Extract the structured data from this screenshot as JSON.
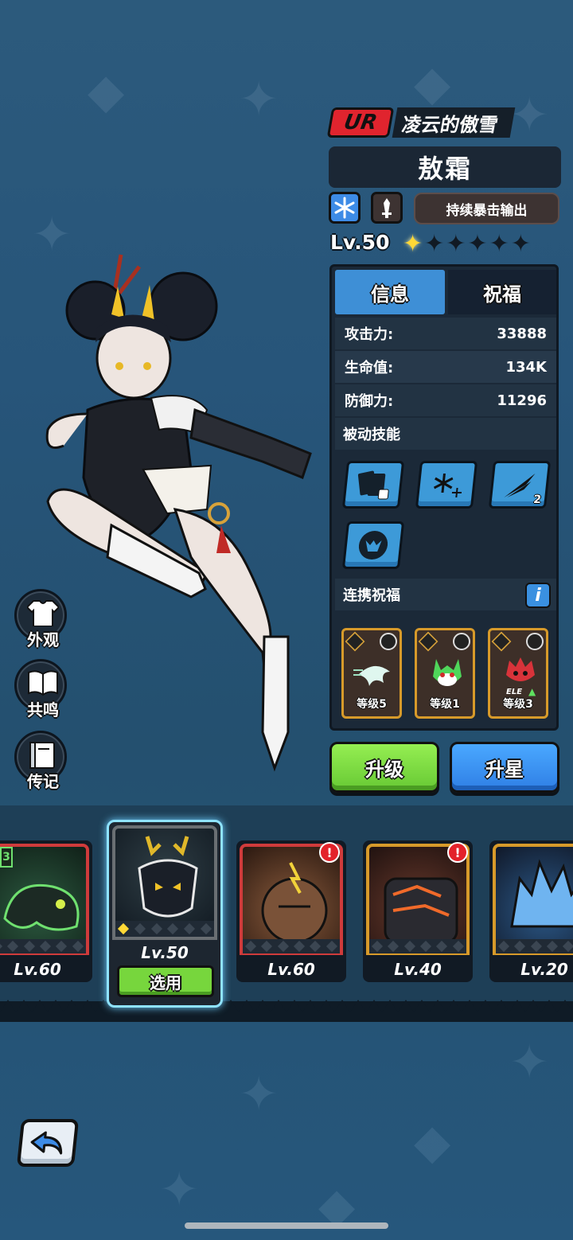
{
  "hero": {
    "rarity": "UR",
    "title": "凌云的傲雪",
    "name": "敖霜",
    "element_icon": "snowflake-icon",
    "type_icon": "sword-icon",
    "trait": "持续暴击输出",
    "level": "Lv.50",
    "stars_total": 6,
    "stars_filled": 1
  },
  "tabs": {
    "info": "信息",
    "blessing": "祝福"
  },
  "stats": [
    {
      "label": "攻击力:",
      "value": "33888"
    },
    {
      "label": "生命值:",
      "value": "134K"
    },
    {
      "label": "防御力:",
      "value": "11296"
    }
  ],
  "passive": {
    "heading": "被动技能",
    "skills": [
      {
        "icon": "cards-dice-icon"
      },
      {
        "icon": "snowflakes-icon"
      },
      {
        "icon": "triple-slash-icon",
        "count": "2"
      },
      {
        "icon": "demon-circle-icon"
      }
    ]
  },
  "link_blessing": {
    "heading": "连携祝福",
    "cards": [
      {
        "icon": "white-dragon-icon",
        "level": "等级5"
      },
      {
        "icon": "green-beast-icon",
        "level": "等级1"
      },
      {
        "icon": "red-boar-icon",
        "level": "等级3",
        "tag": "ELE"
      }
    ]
  },
  "buttons": {
    "upgrade": "升级",
    "star_up": "升星"
  },
  "side_menu": [
    {
      "label": "外观",
      "icon": "shirt-icon"
    },
    {
      "label": "共鸣",
      "icon": "book-icon"
    },
    {
      "label": "传记",
      "icon": "journal-icon"
    }
  ],
  "pets": [
    {
      "level": "Lv.60",
      "alert": false,
      "badge": "3"
    },
    {
      "level": "Lv.50",
      "selected": true,
      "button": "选用"
    },
    {
      "level": "Lv.60",
      "alert": true,
      "alert_text": "!"
    },
    {
      "level": "Lv.40",
      "alert": true,
      "alert_text": "!"
    },
    {
      "level": "Lv.20",
      "alert": false
    }
  ],
  "colors": {
    "accent_blue": "#3e8fd6",
    "accent_green": "#77d63d",
    "rarity_red": "#e0242e",
    "star_gold": "#ffd836"
  }
}
